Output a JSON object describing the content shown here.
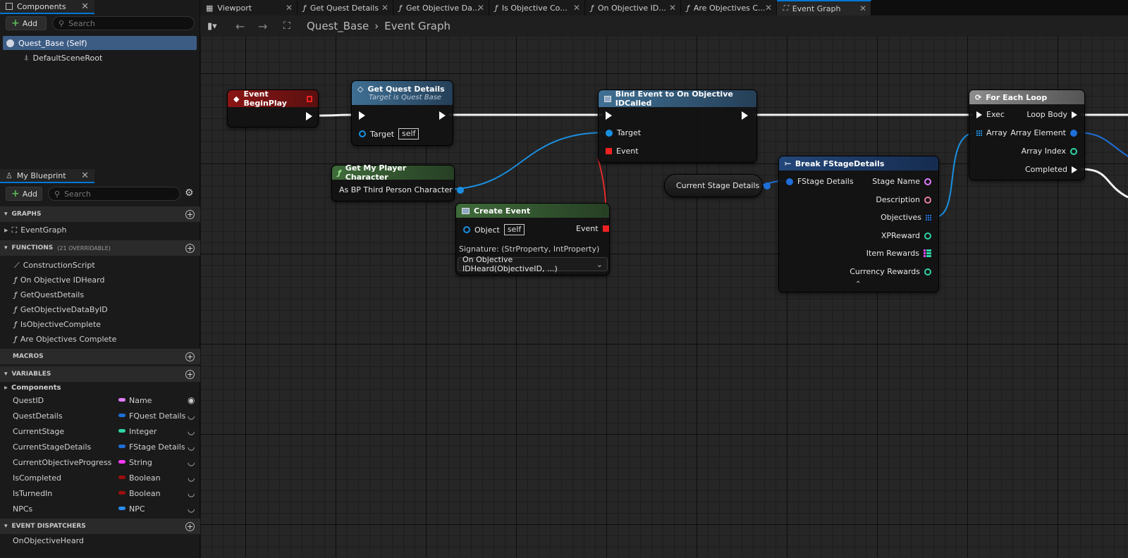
{
  "components_panel": {
    "tab_label": "Components",
    "add_label": "Add",
    "search_placeholder": "Search",
    "items": [
      {
        "label": "Quest_Base (Self)"
      },
      {
        "label": "DefaultSceneRoot"
      }
    ]
  },
  "my_blueprint": {
    "tab_label": "My Blueprint",
    "add_label": "Add",
    "search_placeholder": "Search",
    "graphs": {
      "header": "GRAPHS",
      "items": [
        "EventGraph"
      ]
    },
    "functions": {
      "header": "FUNCTIONS",
      "note": "(21 OVERRIDABLE)",
      "items": [
        "ConstructionScript",
        "On Objective IDHeard",
        "GetQuestDetails",
        "GetObjectiveDataByID",
        "IsObjectiveComplete",
        "Are Objectives Complete"
      ]
    },
    "macros": {
      "header": "MACROS"
    },
    "variables": {
      "header": "VARIABLES",
      "components_label": "Components",
      "items": [
        {
          "name": "QuestID",
          "type": "Name",
          "color": "#e27dff"
        },
        {
          "name": "QuestDetails",
          "type": "FQuest Details",
          "color": "#1e6fd9"
        },
        {
          "name": "CurrentStage",
          "type": "Integer",
          "color": "#2fd4a8"
        },
        {
          "name": "CurrentStageDetails",
          "type": "FStage Details",
          "color": "#1e6fd9"
        },
        {
          "name": "CurrentObjectiveProgress",
          "type": "String",
          "color": "#ff39ff"
        },
        {
          "name": "IsCompleted",
          "type": "Boolean",
          "color": "#9b0e0e"
        },
        {
          "name": "IsTurnedIn",
          "type": "Boolean",
          "color": "#9b0e0e"
        },
        {
          "name": "NPCs",
          "type": "NPC",
          "color": "#2a8df0"
        }
      ]
    },
    "event_dispatchers": {
      "header": "EVENT DISPATCHERS",
      "items": [
        "OnObjectiveHeard"
      ]
    }
  },
  "editor_tabs": [
    {
      "label": "Viewport",
      "icon": "viewport-icon"
    },
    {
      "label": "Get Quest Details",
      "icon": "function-icon"
    },
    {
      "label": "Get Objective Da...",
      "icon": "function-icon"
    },
    {
      "label": "Is Objective Co...",
      "icon": "function-icon"
    },
    {
      "label": "On Objective ID...",
      "icon": "function-icon"
    },
    {
      "label": "Are Objectives C...",
      "icon": "function-icon"
    },
    {
      "label": "Event Graph",
      "icon": "graph-icon",
      "active": true
    }
  ],
  "breadcrumb": {
    "blueprint": "Quest_Base",
    "graph": "Event Graph"
  },
  "nodes": {
    "begin_play": {
      "title": "Event BeginPlay"
    },
    "get_quest_details": {
      "title": "Get Quest Details",
      "subtitle": "Target is Quest Base",
      "target_label": "Target",
      "target_value": "self"
    },
    "bind_event": {
      "title": "Bind Event to On Objective IDCalled",
      "target_label": "Target",
      "event_label": "Event"
    },
    "get_player_character": {
      "title": "Get My Player Character",
      "output_label": "As BP Third Person Character"
    },
    "create_event": {
      "title": "Create Event",
      "object_label": "Object",
      "object_value": "self",
      "event_label": "Event",
      "signature": "Signature: (StrProperty, IntProperty)",
      "function_select": "On Objective IDHeard(ObjectiveID, ...)"
    },
    "current_stage_details": {
      "label": "Current Stage Details"
    },
    "break_fstage": {
      "title": "Break FStageDetails",
      "input_label": "FStage Details",
      "outputs": [
        "Stage Name",
        "Description",
        "Objectives",
        "XPReward",
        "Item Rewards",
        "Currency Rewards"
      ]
    },
    "for_each_loop": {
      "title": "For Each Loop",
      "exec_label": "Exec",
      "array_label": "Array",
      "loop_body_label": "Loop Body",
      "array_element_label": "Array Element",
      "array_index_label": "Array Index",
      "completed_label": "Completed"
    }
  }
}
